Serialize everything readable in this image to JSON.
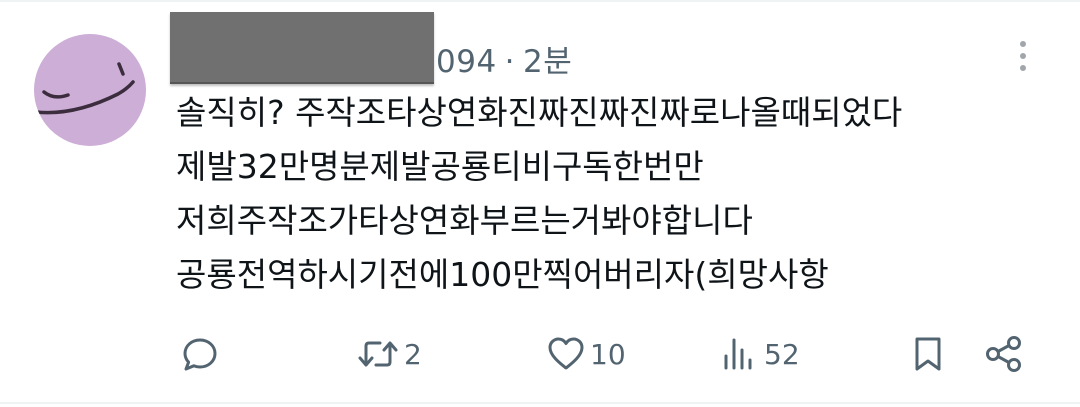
{
  "header": {
    "handle_suffix": "094",
    "separator": "·",
    "time_ago": "2분"
  },
  "tweet": {
    "lines": [
      "솔직히? 주작조타상연화진짜진짜진짜로나올때되었다",
      "제발32만명분제발공룡티비구독한번만",
      "저희주작조가타상연화부르는거봐야합니다",
      "공룡전역하시기전에100만찍어버리자(희망사항"
    ]
  },
  "actions": {
    "replies": "",
    "retweets": "2",
    "likes": "10",
    "views": "52"
  },
  "colors": {
    "avatar_bg": "#ccaed7",
    "muted": "#536471",
    "text": "#0f1419"
  }
}
